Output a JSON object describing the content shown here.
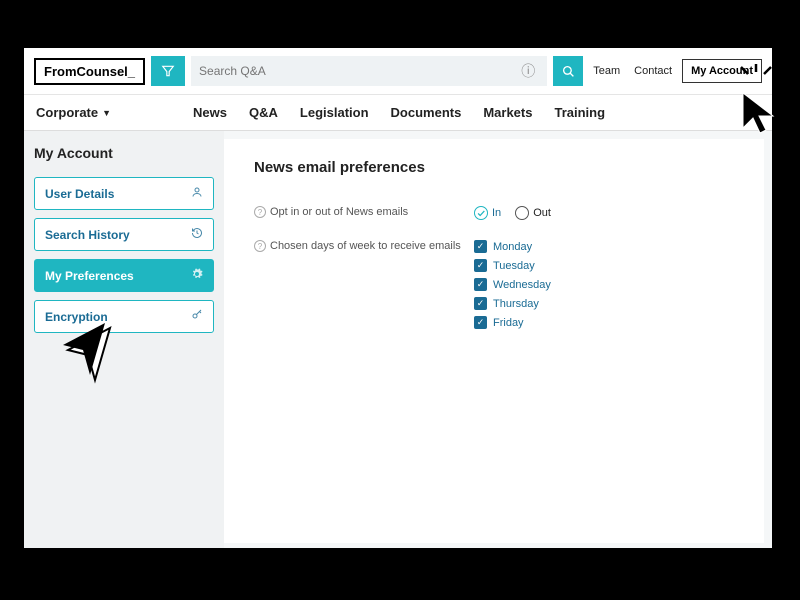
{
  "logo": {
    "part1": "From",
    "part2": "Counsel_"
  },
  "search": {
    "placeholder": "Search Q&A"
  },
  "topLinks": {
    "team": "Team",
    "contact": "Contact",
    "account": "My Account"
  },
  "nav": {
    "corporate": "Corporate",
    "items": [
      "News",
      "Q&A",
      "Legislation",
      "Documents",
      "Markets",
      "Training"
    ]
  },
  "sidebar": {
    "title": "My Account",
    "items": [
      {
        "label": "User Details"
      },
      {
        "label": "Search History"
      },
      {
        "label": "My Preferences"
      },
      {
        "label": "Encryption"
      }
    ]
  },
  "main": {
    "title": "News email preferences",
    "opt": {
      "label": "Opt in or out of News emails",
      "in": "In",
      "out": "Out"
    },
    "days": {
      "label": "Chosen days of week to receive emails",
      "list": [
        "Monday",
        "Tuesday",
        "Wednesday",
        "Thursday",
        "Friday"
      ]
    }
  }
}
